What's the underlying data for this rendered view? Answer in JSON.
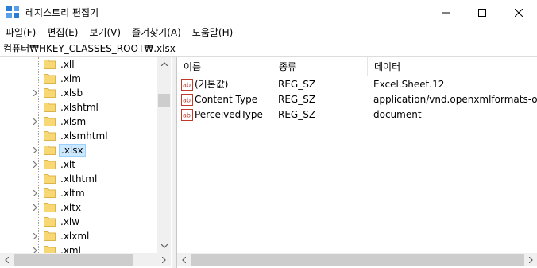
{
  "window": {
    "title": "레지스트리 편집기",
    "controls": [
      "minimize-icon",
      "maximize-icon",
      "close-icon"
    ]
  },
  "menu": {
    "items": [
      {
        "label": "파일(F)"
      },
      {
        "label": "편집(E)"
      },
      {
        "label": "보기(V)"
      },
      {
        "label": "즐겨찾기(A)"
      },
      {
        "label": "도움말(H)"
      }
    ]
  },
  "address": {
    "path": "컴퓨터₩HKEY_CLASSES_ROOT₩.xlsx"
  },
  "tree": {
    "items": [
      {
        "label": ".xll",
        "expandable": false,
        "selected": false
      },
      {
        "label": ".xlm",
        "expandable": false,
        "selected": false
      },
      {
        "label": ".xlsb",
        "expandable": true,
        "selected": false
      },
      {
        "label": ".xlshtml",
        "expandable": false,
        "selected": false
      },
      {
        "label": ".xlsm",
        "expandable": true,
        "selected": false
      },
      {
        "label": ".xlsmhtml",
        "expandable": false,
        "selected": false
      },
      {
        "label": ".xlsx",
        "expandable": true,
        "selected": true
      },
      {
        "label": ".xlt",
        "expandable": true,
        "selected": false
      },
      {
        "label": ".xlthtml",
        "expandable": false,
        "selected": false
      },
      {
        "label": ".xltm",
        "expandable": true,
        "selected": false
      },
      {
        "label": ".xltx",
        "expandable": true,
        "selected": false
      },
      {
        "label": ".xlw",
        "expandable": false,
        "selected": false
      },
      {
        "label": ".xlxml",
        "expandable": true,
        "selected": false
      },
      {
        "label": ".xml",
        "expandable": true,
        "selected": false
      }
    ]
  },
  "list": {
    "columns": {
      "name": "이름",
      "type": "종류",
      "data": "데이터"
    },
    "rows": [
      {
        "name": "(기본값)",
        "type": "REG_SZ",
        "data": "Excel.Sheet.12"
      },
      {
        "name": "Content Type",
        "type": "REG_SZ",
        "data": "application/vnd.openxmlformats-offic"
      },
      {
        "name": "PerceivedType",
        "type": "REG_SZ",
        "data": "document"
      }
    ]
  },
  "colors": {
    "selection": "#cce8ff",
    "selection_border": "#99d1ff",
    "folder": "#f8d775",
    "icon_red": "#c0392b"
  }
}
